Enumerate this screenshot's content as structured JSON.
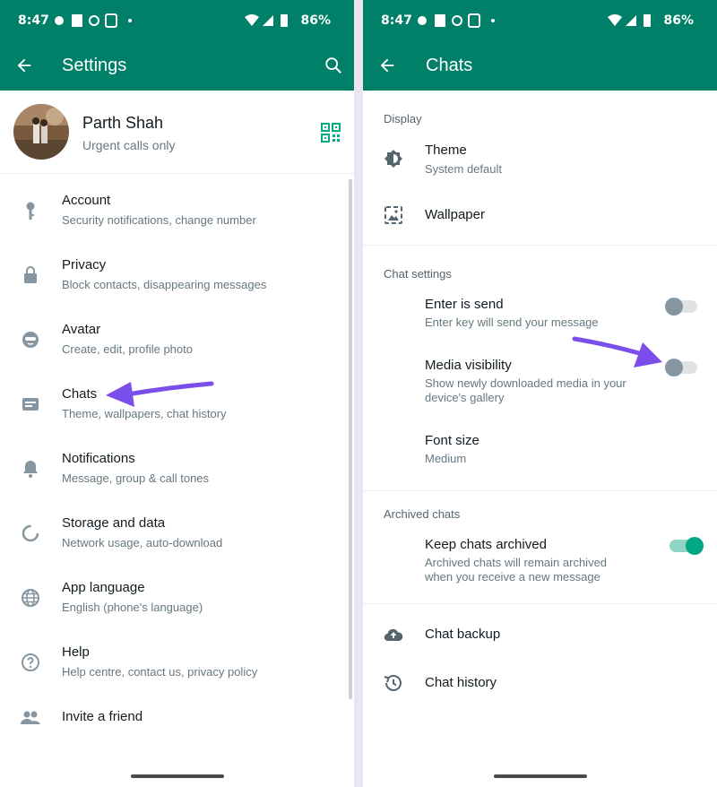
{
  "status": {
    "time": "8:47",
    "battery": "86%"
  },
  "left": {
    "title": "Settings",
    "profile": {
      "name": "Parth Shah",
      "status": "Urgent calls only"
    },
    "items": [
      {
        "title": "Account",
        "subtitle": "Security notifications, change number",
        "icon": "key-icon"
      },
      {
        "title": "Privacy",
        "subtitle": "Block contacts, disappearing messages",
        "icon": "lock-icon"
      },
      {
        "title": "Avatar",
        "subtitle": "Create, edit, profile photo",
        "icon": "avatar-face-icon"
      },
      {
        "title": "Chats",
        "subtitle": "Theme, wallpapers, chat history",
        "icon": "chat-icon"
      },
      {
        "title": "Notifications",
        "subtitle": "Message, group & call tones",
        "icon": "bell-icon"
      },
      {
        "title": "Storage and data",
        "subtitle": "Network usage, auto-download",
        "icon": "storage-ring-icon"
      },
      {
        "title": "App language",
        "subtitle": "English (phone's language)",
        "icon": "globe-icon"
      },
      {
        "title": "Help",
        "subtitle": "Help centre, contact us, privacy policy",
        "icon": "help-icon"
      },
      {
        "title": "Invite a friend",
        "subtitle": "",
        "icon": "people-icon"
      }
    ]
  },
  "right": {
    "title": "Chats",
    "display": {
      "heading": "Display",
      "theme": {
        "title": "Theme",
        "subtitle": "System default"
      },
      "wallpaper": {
        "title": "Wallpaper"
      }
    },
    "chat_settings": {
      "heading": "Chat settings",
      "enter_is_send": {
        "title": "Enter is send",
        "subtitle": "Enter key will send your message",
        "on": false
      },
      "media_visibility": {
        "title": "Media visibility",
        "subtitle1": "Show newly downloaded media in your",
        "subtitle2": "device's gallery",
        "on": false
      },
      "font_size": {
        "title": "Font size",
        "subtitle": "Medium"
      }
    },
    "archived": {
      "heading": "Archived chats",
      "keep_archived": {
        "title": "Keep chats archived",
        "subtitle1": "Archived chats will remain archived",
        "subtitle2": "when you receive a new message",
        "on": true
      }
    },
    "backup": {
      "title": "Chat backup"
    },
    "history": {
      "title": "Chat history"
    }
  },
  "colors": {
    "header": "#008069",
    "accent": "#00a884",
    "annotation_arrow": "#7b4dea"
  }
}
